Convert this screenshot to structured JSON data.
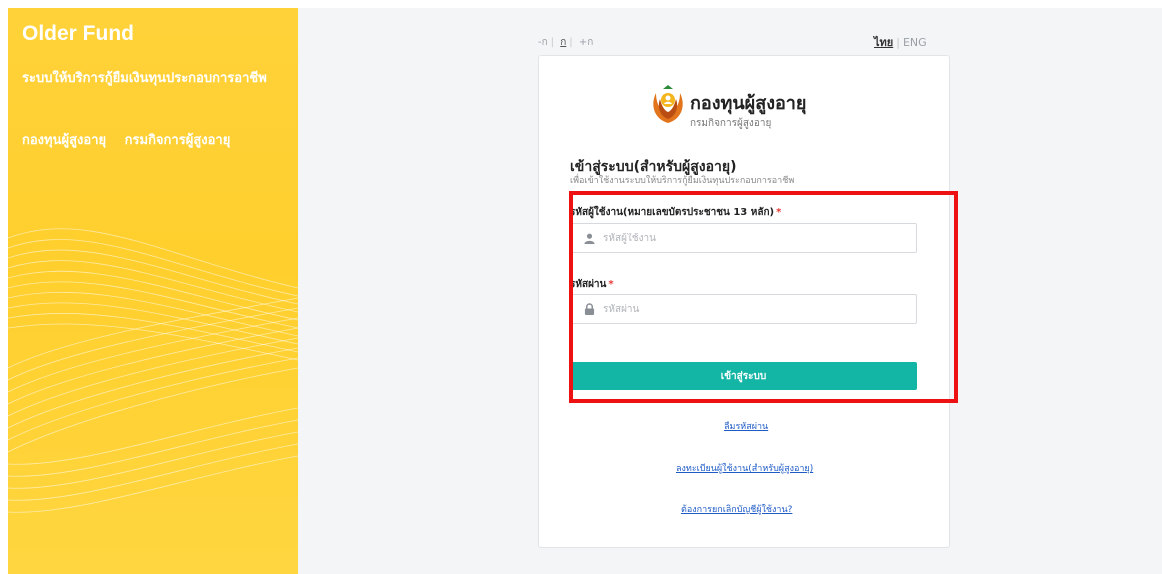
{
  "sidebar": {
    "title": "Older Fund",
    "subtitle": "ระบบให้บริการกู้ยืมเงินทุนประกอบการอาชีพ",
    "links": [
      "กองทุนผู้สูงอายุ",
      "กรมกิจการผู้สูงอายุ"
    ]
  },
  "font_size_links": [
    {
      "label": "-ก",
      "active": false
    },
    {
      "label": "ก",
      "active": true
    },
    {
      "label": "+ก",
      "active": false
    }
  ],
  "language": {
    "thai": "ไทย",
    "eng": "ENG",
    "selected": "ไทย"
  },
  "logo": {
    "title": "กองทุนผู้สูงอายุ",
    "subtitle": "กรมกิจการผู้สูงอายุ",
    "colors": {
      "orange": "#e2741c",
      "gold": "#f3b61e",
      "green": "#2e8b3c"
    }
  },
  "login": {
    "title": "เข้าสู่ระบบ(สำหรับผู้สูงอายุ)",
    "description": "เพื่อเข้าใช้งานระบบให้บริการกู้ยืมเงินทุนประกอบการอาชีพ",
    "username_label": "รหัสผู้ใช้งาน(หมายเลขบัตรประชาชน 13 หลัก)",
    "username_placeholder": "รหัสผู้ใช้งาน",
    "username_value": "",
    "password_label": "รหัสผ่าน",
    "password_placeholder": "รหัสผ่าน",
    "password_value": "",
    "required_mark": "*",
    "submit_label": "เข้าสู่ระบบ"
  },
  "links": {
    "forgot_password": "ลืมรหัสผ่าน",
    "register": "ลงทะเบียนผู้ใช้งาน(สำหรับผู้สูงอายุ)",
    "cancel_account": "ต้องการยกเลิกบัญชีผู้ใช้งาน?"
  },
  "icons": {
    "username": "user-icon",
    "password": "lock-icon"
  },
  "colors": {
    "sidebar_bg": "#ffd23a",
    "button": "#13b5a5",
    "highlight": "#ee1111",
    "link": "#1e5bc6"
  }
}
